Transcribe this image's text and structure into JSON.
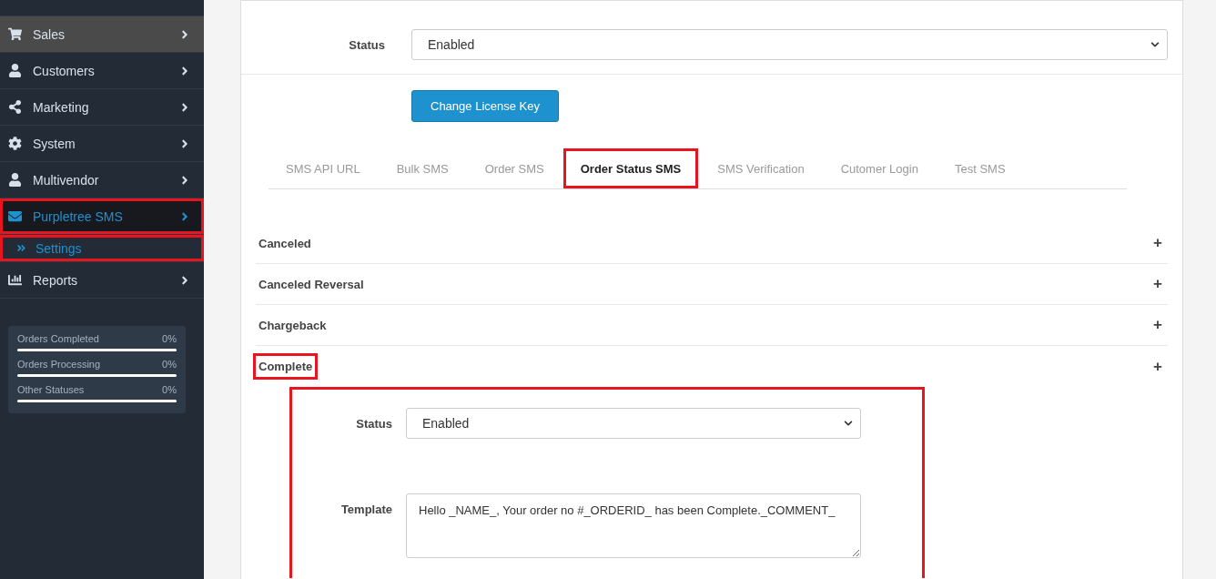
{
  "sidebar": {
    "items": [
      {
        "label": "Sales",
        "hovered": true,
        "active": false,
        "highlighted": false
      },
      {
        "label": "Customers",
        "hovered": false,
        "active": false,
        "highlighted": false
      },
      {
        "label": "Marketing",
        "hovered": false,
        "active": false,
        "highlighted": false
      },
      {
        "label": "System",
        "hovered": false,
        "active": false,
        "highlighted": false
      },
      {
        "label": "Multivendor",
        "hovered": false,
        "active": false,
        "highlighted": false
      },
      {
        "label": "Purpletree SMS",
        "hovered": false,
        "active": true,
        "highlighted": true,
        "children": [
          {
            "label": "Settings",
            "highlighted": true
          }
        ]
      },
      {
        "label": "Reports",
        "hovered": false,
        "active": false,
        "highlighted": false
      }
    ],
    "stats": [
      {
        "label": "Orders Completed",
        "value": "0%",
        "level": 0
      },
      {
        "label": "Orders Processing",
        "value": "0%",
        "level": 0
      },
      {
        "label": "Other Statuses",
        "value": "0%",
        "level": 0
      }
    ]
  },
  "form": {
    "status": {
      "label": "Status",
      "value": "Enabled"
    },
    "button": "Change License Key"
  },
  "tabs": [
    {
      "label": "SMS API URL",
      "selected": false,
      "highlighted": false
    },
    {
      "label": "Bulk SMS",
      "selected": false,
      "highlighted": false
    },
    {
      "label": "Order SMS",
      "selected": false,
      "highlighted": false
    },
    {
      "label": "Order Status SMS",
      "selected": true,
      "highlighted": true
    },
    {
      "label": "SMS Verification",
      "selected": false,
      "highlighted": false
    },
    {
      "label": "Cutomer Login",
      "selected": false,
      "highlighted": false
    },
    {
      "label": "Test SMS",
      "selected": false,
      "highlighted": false
    }
  ],
  "accordion": [
    {
      "title": "Canceled",
      "expanded": false,
      "highlighted": false,
      "toggle": "+"
    },
    {
      "title": "Canceled Reversal",
      "expanded": false,
      "highlighted": false,
      "toggle": "+"
    },
    {
      "title": "Chargeback",
      "expanded": false,
      "highlighted": false,
      "toggle": "+"
    },
    {
      "title": "Complete",
      "expanded": true,
      "highlighted": true,
      "toggle": "+",
      "status": {
        "label": "Status",
        "value": "Enabled"
      },
      "template": {
        "label": "Template",
        "value": "Hello _NAME_, Your order no #_ORDERID_ has been Complete._COMMENT_"
      }
    }
  ]
}
